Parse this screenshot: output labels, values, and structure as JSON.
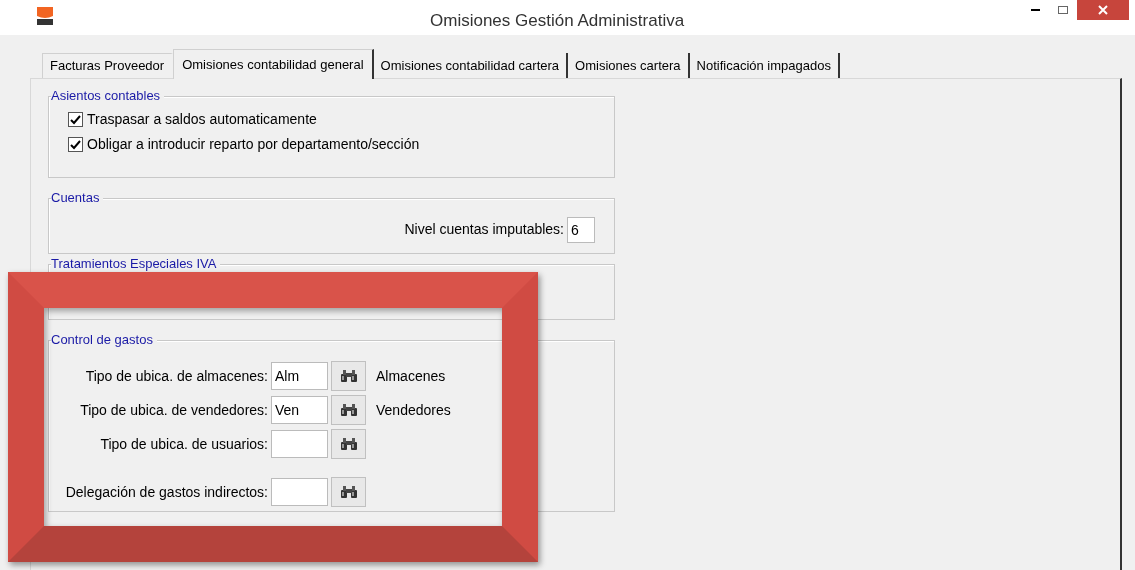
{
  "window": {
    "title": "Omisiones Gestión Administrativa"
  },
  "tabs": [
    {
      "label": "Facturas Proveedor",
      "selected": false
    },
    {
      "label": "Omisiones contabilidad general",
      "selected": true
    },
    {
      "label": "Omisiones contabilidad cartera",
      "selected": false
    },
    {
      "label": "Omisiones cartera",
      "selected": false
    },
    {
      "label": "Notificación impagados",
      "selected": false
    }
  ],
  "asientos_contables": {
    "title": "Asientos contables",
    "options": [
      {
        "label": "Traspasar a saldos automaticamente",
        "checked": true
      },
      {
        "label": "Obligar a introducir reparto por departamento/sección",
        "checked": true
      }
    ]
  },
  "cuentas": {
    "title": "Cuentas",
    "field": {
      "label": "Nivel cuentas imputables:",
      "value": "6"
    }
  },
  "tratamientos_especiales_iva": {
    "title": "Tratamientos Especiales IVA"
  },
  "control_de_gastos": {
    "title": "Control de gastos",
    "rows": [
      {
        "label": "Tipo de ubica. de almacenes:",
        "value": "Alm",
        "description": "Almacenes"
      },
      {
        "label": "Tipo de ubica. de vendedores:",
        "value": "Ven",
        "description": "Vendedores"
      },
      {
        "label": "Tipo de ubica. de usuarios:",
        "value": ""
      },
      {
        "label": "Delegación de gastos indirectos:",
        "value": "",
        "gap": true
      }
    ]
  }
}
